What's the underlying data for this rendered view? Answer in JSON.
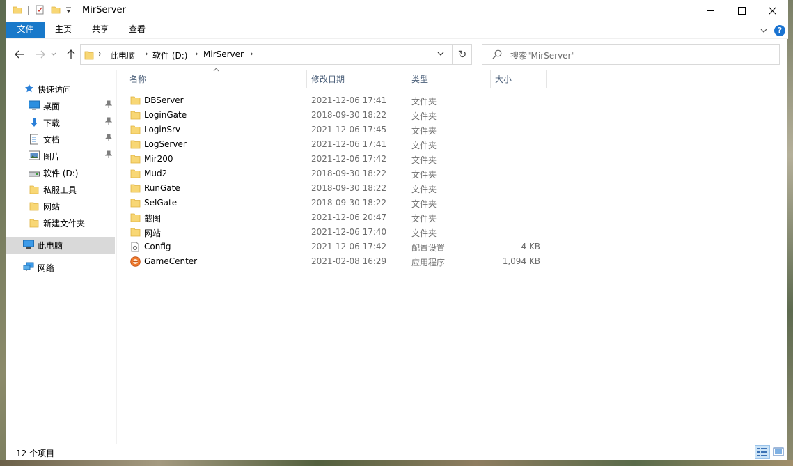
{
  "window": {
    "title": "MirServer"
  },
  "ribbon": {
    "tabs": [
      "文件",
      "主页",
      "共享",
      "查看"
    ],
    "help_symbol": "?"
  },
  "address": {
    "crumbs": [
      "此电脑",
      "软件 (D:)",
      "MirServer"
    ],
    "refresh_symbol": "↻"
  },
  "search": {
    "placeholder": "搜索\"MirServer\""
  },
  "nav": {
    "quick_access": "快速访问",
    "items": [
      {
        "label": "桌面",
        "icon": "desktop-icon",
        "pinned": true
      },
      {
        "label": "下载",
        "icon": "download-icon",
        "pinned": true
      },
      {
        "label": "文档",
        "icon": "documents-icon",
        "pinned": true
      },
      {
        "label": "图片",
        "icon": "pictures-icon",
        "pinned": true
      },
      {
        "label": "软件 (D:)",
        "icon": "drive-icon",
        "pinned": false
      },
      {
        "label": "私服工具",
        "icon": "folder-icon",
        "pinned": false
      },
      {
        "label": "网站",
        "icon": "folder-icon",
        "pinned": false
      },
      {
        "label": "新建文件夹",
        "icon": "folder-icon",
        "pinned": false
      }
    ],
    "this_pc": "此电脑",
    "network": "网络"
  },
  "columns": {
    "name": "名称",
    "date": "修改日期",
    "type": "类型",
    "size": "大小"
  },
  "files": [
    {
      "name": "DBServer",
      "date": "2021-12-06 17:41",
      "type": "文件夹",
      "size": "",
      "icon": "folder-icon"
    },
    {
      "name": "LoginGate",
      "date": "2018-09-30 18:22",
      "type": "文件夹",
      "size": "",
      "icon": "folder-icon"
    },
    {
      "name": "LoginSrv",
      "date": "2021-12-06 17:45",
      "type": "文件夹",
      "size": "",
      "icon": "folder-icon"
    },
    {
      "name": "LogServer",
      "date": "2021-12-06 17:41",
      "type": "文件夹",
      "size": "",
      "icon": "folder-icon"
    },
    {
      "name": "Mir200",
      "date": "2021-12-06 17:42",
      "type": "文件夹",
      "size": "",
      "icon": "folder-icon"
    },
    {
      "name": "Mud2",
      "date": "2018-09-30 18:22",
      "type": "文件夹",
      "size": "",
      "icon": "folder-icon"
    },
    {
      "name": "RunGate",
      "date": "2018-09-30 18:22",
      "type": "文件夹",
      "size": "",
      "icon": "folder-icon"
    },
    {
      "name": "SelGate",
      "date": "2018-09-30 18:22",
      "type": "文件夹",
      "size": "",
      "icon": "folder-icon"
    },
    {
      "name": "截图",
      "date": "2021-12-06 20:47",
      "type": "文件夹",
      "size": "",
      "icon": "folder-icon"
    },
    {
      "name": "网站",
      "date": "2021-12-06 17:40",
      "type": "文件夹",
      "size": "",
      "icon": "folder-icon"
    },
    {
      "name": "Config",
      "date": "2021-12-06 17:42",
      "type": "配置设置",
      "size": "4 KB",
      "icon": "config-file-icon"
    },
    {
      "name": "GameCenter",
      "date": "2021-02-08 16:29",
      "type": "应用程序",
      "size": "1,094 KB",
      "icon": "app-icon"
    }
  ],
  "status": {
    "item_count": "12 个项目"
  },
  "colors": {
    "accent": "#1979ca",
    "folder": "#f8d775",
    "selected_nav": "#d9d9d9",
    "header_text": "#4c607a"
  }
}
